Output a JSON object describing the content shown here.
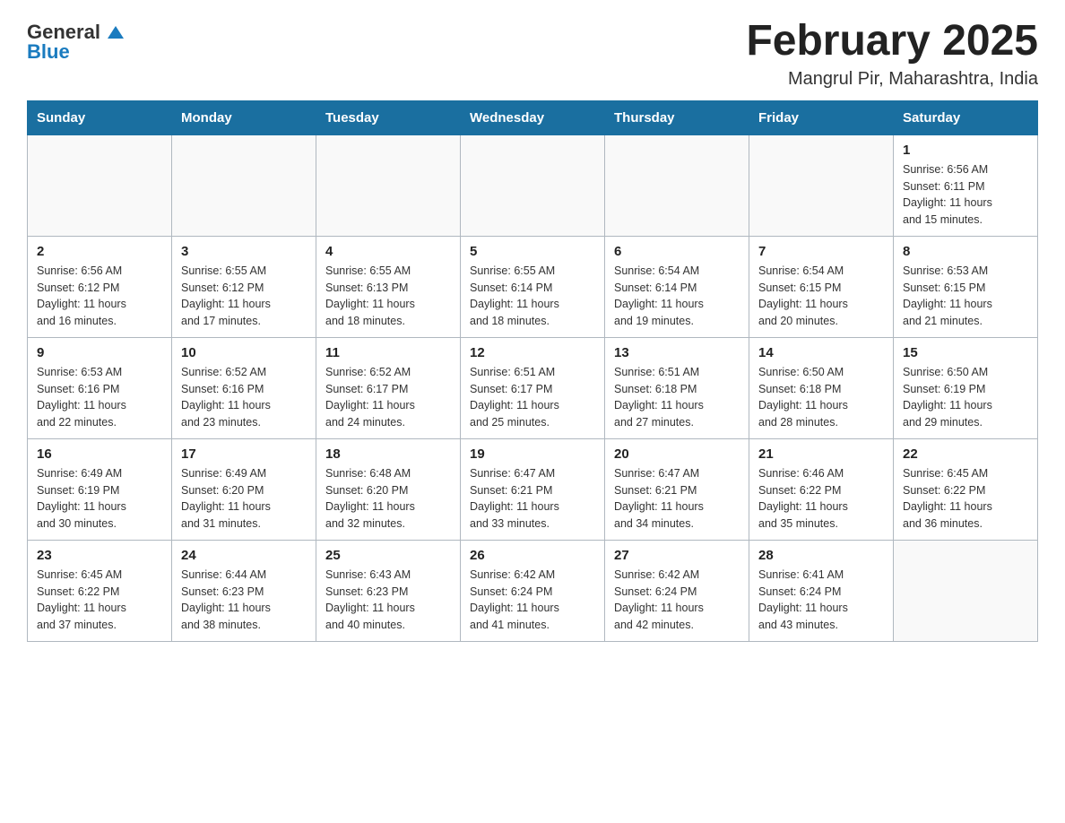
{
  "header": {
    "logo_general": "General",
    "logo_blue": "Blue",
    "month_title": "February 2025",
    "location": "Mangrul Pir, Maharashtra, India"
  },
  "weekdays": [
    "Sunday",
    "Monday",
    "Tuesday",
    "Wednesday",
    "Thursday",
    "Friday",
    "Saturday"
  ],
  "weeks": [
    [
      {
        "day": "",
        "info": ""
      },
      {
        "day": "",
        "info": ""
      },
      {
        "day": "",
        "info": ""
      },
      {
        "day": "",
        "info": ""
      },
      {
        "day": "",
        "info": ""
      },
      {
        "day": "",
        "info": ""
      },
      {
        "day": "1",
        "info": "Sunrise: 6:56 AM\nSunset: 6:11 PM\nDaylight: 11 hours\nand 15 minutes."
      }
    ],
    [
      {
        "day": "2",
        "info": "Sunrise: 6:56 AM\nSunset: 6:12 PM\nDaylight: 11 hours\nand 16 minutes."
      },
      {
        "day": "3",
        "info": "Sunrise: 6:55 AM\nSunset: 6:12 PM\nDaylight: 11 hours\nand 17 minutes."
      },
      {
        "day": "4",
        "info": "Sunrise: 6:55 AM\nSunset: 6:13 PM\nDaylight: 11 hours\nand 18 minutes."
      },
      {
        "day": "5",
        "info": "Sunrise: 6:55 AM\nSunset: 6:14 PM\nDaylight: 11 hours\nand 18 minutes."
      },
      {
        "day": "6",
        "info": "Sunrise: 6:54 AM\nSunset: 6:14 PM\nDaylight: 11 hours\nand 19 minutes."
      },
      {
        "day": "7",
        "info": "Sunrise: 6:54 AM\nSunset: 6:15 PM\nDaylight: 11 hours\nand 20 minutes."
      },
      {
        "day": "8",
        "info": "Sunrise: 6:53 AM\nSunset: 6:15 PM\nDaylight: 11 hours\nand 21 minutes."
      }
    ],
    [
      {
        "day": "9",
        "info": "Sunrise: 6:53 AM\nSunset: 6:16 PM\nDaylight: 11 hours\nand 22 minutes."
      },
      {
        "day": "10",
        "info": "Sunrise: 6:52 AM\nSunset: 6:16 PM\nDaylight: 11 hours\nand 23 minutes."
      },
      {
        "day": "11",
        "info": "Sunrise: 6:52 AM\nSunset: 6:17 PM\nDaylight: 11 hours\nand 24 minutes."
      },
      {
        "day": "12",
        "info": "Sunrise: 6:51 AM\nSunset: 6:17 PM\nDaylight: 11 hours\nand 25 minutes."
      },
      {
        "day": "13",
        "info": "Sunrise: 6:51 AM\nSunset: 6:18 PM\nDaylight: 11 hours\nand 27 minutes."
      },
      {
        "day": "14",
        "info": "Sunrise: 6:50 AM\nSunset: 6:18 PM\nDaylight: 11 hours\nand 28 minutes."
      },
      {
        "day": "15",
        "info": "Sunrise: 6:50 AM\nSunset: 6:19 PM\nDaylight: 11 hours\nand 29 minutes."
      }
    ],
    [
      {
        "day": "16",
        "info": "Sunrise: 6:49 AM\nSunset: 6:19 PM\nDaylight: 11 hours\nand 30 minutes."
      },
      {
        "day": "17",
        "info": "Sunrise: 6:49 AM\nSunset: 6:20 PM\nDaylight: 11 hours\nand 31 minutes."
      },
      {
        "day": "18",
        "info": "Sunrise: 6:48 AM\nSunset: 6:20 PM\nDaylight: 11 hours\nand 32 minutes."
      },
      {
        "day": "19",
        "info": "Sunrise: 6:47 AM\nSunset: 6:21 PM\nDaylight: 11 hours\nand 33 minutes."
      },
      {
        "day": "20",
        "info": "Sunrise: 6:47 AM\nSunset: 6:21 PM\nDaylight: 11 hours\nand 34 minutes."
      },
      {
        "day": "21",
        "info": "Sunrise: 6:46 AM\nSunset: 6:22 PM\nDaylight: 11 hours\nand 35 minutes."
      },
      {
        "day": "22",
        "info": "Sunrise: 6:45 AM\nSunset: 6:22 PM\nDaylight: 11 hours\nand 36 minutes."
      }
    ],
    [
      {
        "day": "23",
        "info": "Sunrise: 6:45 AM\nSunset: 6:22 PM\nDaylight: 11 hours\nand 37 minutes."
      },
      {
        "day": "24",
        "info": "Sunrise: 6:44 AM\nSunset: 6:23 PM\nDaylight: 11 hours\nand 38 minutes."
      },
      {
        "day": "25",
        "info": "Sunrise: 6:43 AM\nSunset: 6:23 PM\nDaylight: 11 hours\nand 40 minutes."
      },
      {
        "day": "26",
        "info": "Sunrise: 6:42 AM\nSunset: 6:24 PM\nDaylight: 11 hours\nand 41 minutes."
      },
      {
        "day": "27",
        "info": "Sunrise: 6:42 AM\nSunset: 6:24 PM\nDaylight: 11 hours\nand 42 minutes."
      },
      {
        "day": "28",
        "info": "Sunrise: 6:41 AM\nSunset: 6:24 PM\nDaylight: 11 hours\nand 43 minutes."
      },
      {
        "day": "",
        "info": ""
      }
    ]
  ]
}
